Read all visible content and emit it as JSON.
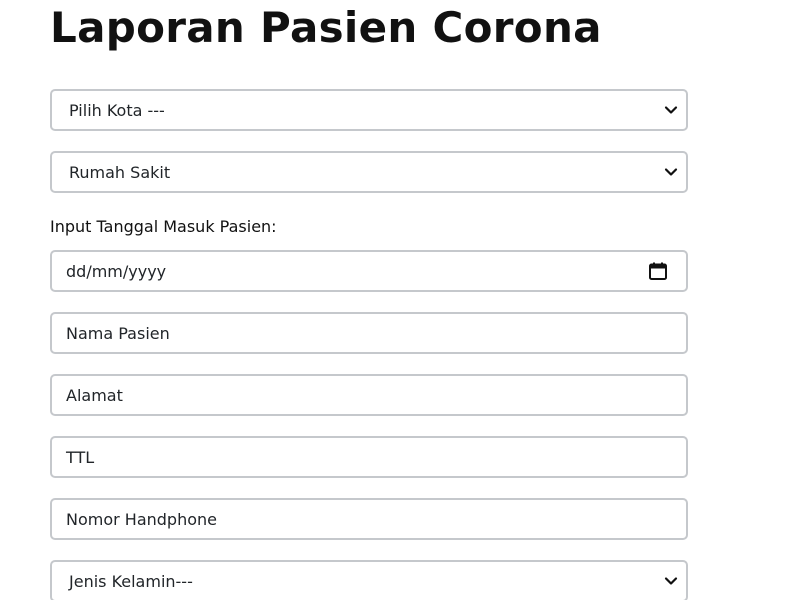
{
  "page": {
    "title": "Laporan Pasien Corona"
  },
  "form": {
    "kota_select": {
      "value": "Pilih Kota ---"
    },
    "rumah_sakit_select": {
      "value": "Rumah Sakit"
    },
    "tanggal_label": "Input Tanggal Masuk Pasien:",
    "tanggal_input": {
      "placeholder": "dd/mm/yyyy"
    },
    "nama_input": {
      "placeholder": "Nama Pasien"
    },
    "alamat_input": {
      "placeholder": "Alamat"
    },
    "ttl_input": {
      "placeholder": "TTL"
    },
    "nomor_input": {
      "placeholder": "Nomor Handphone"
    },
    "jenis_kelamin_select": {
      "value": "Jenis Kelamin---"
    }
  },
  "icons": {
    "select_arrow": "chevron-down-icon",
    "date_picker": "calendar-icon"
  },
  "colors": {
    "border": "#c5c8cc",
    "text": "#212529"
  }
}
